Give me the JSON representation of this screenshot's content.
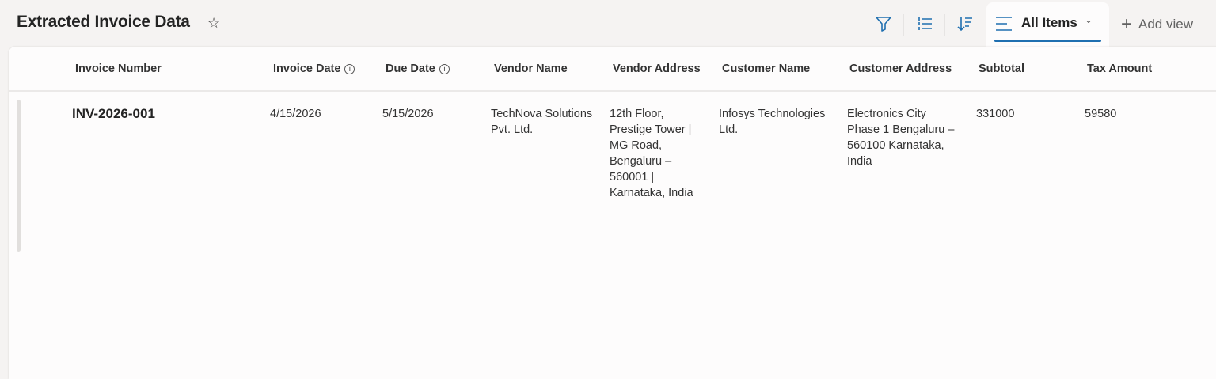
{
  "header": {
    "title": "Extracted Invoice Data",
    "favorite_icon": "star-icon"
  },
  "toolbar": {
    "filter_icon": "filter-icon",
    "group_icon": "list-icon",
    "sort_icon": "sort-icon",
    "view_label": "All Items",
    "add_view_label": "Add view",
    "accent": "#1f6fb0"
  },
  "table": {
    "columns": [
      "Invoice Number",
      "Invoice Date",
      "Due Date",
      "Vendor Name",
      "Vendor Address",
      "Customer Name",
      "Customer Address",
      "Subtotal",
      "Tax Amount"
    ],
    "rows": [
      {
        "invoice_number": "INV-2026-001",
        "invoice_date": "4/15/2026",
        "due_date": "5/15/2026",
        "vendor_name": "TechNova Solutions Pvt. Ltd.",
        "vendor_address": "12th Floor, Prestige Tower | MG Road, Bengaluru – 560001 | Karnataka, India",
        "customer_name": "Infosys Technologies Ltd.",
        "customer_address": "Electronics City Phase 1 Bengaluru – 560100 Karnataka, India",
        "subtotal": "331000",
        "tax_amount": "59580"
      }
    ]
  }
}
